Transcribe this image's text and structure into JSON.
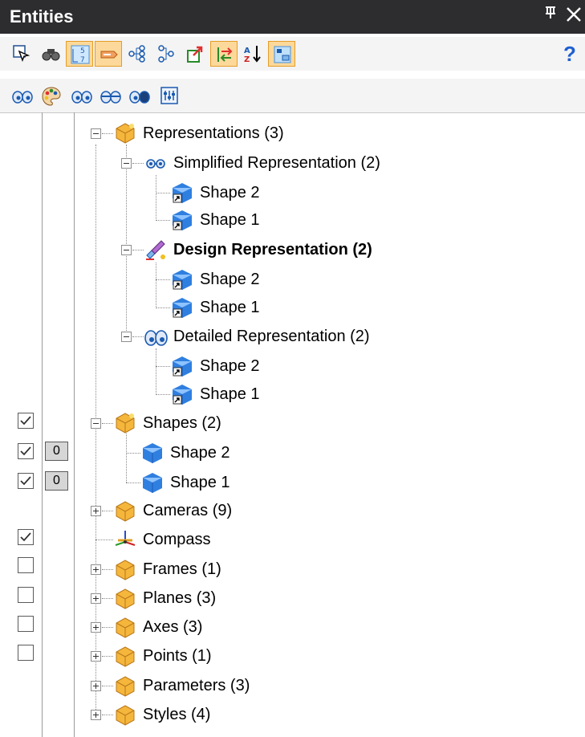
{
  "title": "Entities",
  "titlebar": {
    "pin_glyph": "⊥",
    "close_glyph": "✕"
  },
  "toolbar1": {
    "buttons": [
      {
        "icon": "select-pointer-icon"
      },
      {
        "icon": "binoculars-icon"
      },
      {
        "icon": "numbered-list-icon",
        "active": true
      },
      {
        "icon": "tag-label-icon",
        "active": true
      },
      {
        "icon": "tree-expand-icon"
      },
      {
        "icon": "tree-collapse-icon"
      },
      {
        "icon": "export-arrow-icon"
      },
      {
        "icon": "sync-arrows-icon",
        "active": true
      },
      {
        "icon": "sort-az-icon"
      },
      {
        "icon": "grid-view-icon",
        "active": true
      }
    ],
    "help_label": "?"
  },
  "toolbar2": {
    "buttons": [
      {
        "icon": "visibility-eyes-icon"
      },
      {
        "icon": "palette-icon"
      },
      {
        "icon": "eyes-open-icon"
      },
      {
        "icon": "eyes-closed-icon"
      },
      {
        "icon": "eyes-hidden-icon"
      },
      {
        "icon": "equalizer-icon"
      }
    ]
  },
  "tree": [
    {
      "label": "Representations (3)",
      "icon": "folder-cube-icon",
      "expander": "minus"
    },
    {
      "label": "Simplified Representation (2)",
      "icon": "glasses-icon",
      "expander": "minus"
    },
    {
      "label": "Shape 2",
      "icon": "shape-link-icon"
    },
    {
      "label": "Shape 1",
      "icon": "shape-link-icon"
    },
    {
      "label": "Design Representation (2)",
      "icon": "design-pencil-icon",
      "expander": "minus",
      "bold": true
    },
    {
      "label": "Shape 2",
      "icon": "shape-link-icon"
    },
    {
      "label": "Shape 1",
      "icon": "shape-link-icon"
    },
    {
      "label": "Detailed Representation (2)",
      "icon": "eyes-detail-icon",
      "expander": "minus"
    },
    {
      "label": "Shape 2",
      "icon": "shape-link-icon"
    },
    {
      "label": "Shape 1",
      "icon": "shape-link-icon"
    },
    {
      "label": "Shapes (2)",
      "icon": "folder-cube-icon",
      "expander": "minus",
      "checkbox": true
    },
    {
      "label": "Shape 2",
      "icon": "shape-cube-icon",
      "checkbox": true,
      "count": "0"
    },
    {
      "label": "Shape 1",
      "icon": "shape-cube-icon",
      "checkbox": true,
      "count": "0"
    },
    {
      "label": "Cameras (9)",
      "icon": "folder-cube-icon",
      "expander": "plus"
    },
    {
      "label": "Compass",
      "icon": "compass-icon",
      "checkbox": true
    },
    {
      "label": "Frames (1)",
      "icon": "folder-cube-icon",
      "expander": "plus",
      "checkbox": false
    },
    {
      "label": "Planes (3)",
      "icon": "folder-cube-icon",
      "expander": "plus",
      "checkbox": false
    },
    {
      "label": "Axes (3)",
      "icon": "folder-cube-icon",
      "expander": "plus",
      "checkbox": false
    },
    {
      "label": "Points (1)",
      "icon": "folder-cube-icon",
      "expander": "plus",
      "checkbox": false
    },
    {
      "label": "Parameters (3)",
      "icon": "folder-cube-icon",
      "expander": "plus"
    },
    {
      "label": "Styles (4)",
      "icon": "folder-cube-icon",
      "expander": "plus"
    }
  ],
  "colors": {
    "titlebar_bg": "#2d2d30",
    "active_button_bg": "#fcd99a",
    "active_button_border": "#e69d28",
    "help_blue": "#1e5fd0",
    "shape_blue": "#2f7fe0",
    "folder_yellow": "#f5b63c"
  }
}
